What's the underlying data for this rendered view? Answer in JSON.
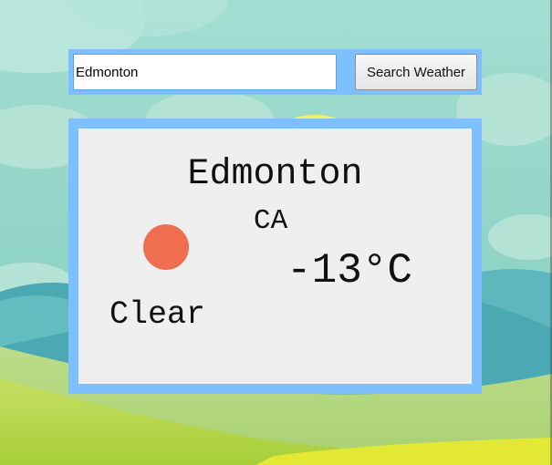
{
  "search": {
    "value": "Edmonton",
    "button_label": "Search Weather"
  },
  "weather": {
    "city": "Edmonton",
    "country": "CA",
    "temperature": "-13°C",
    "condition": "Clear",
    "icon": "sun-icon"
  },
  "colors": {
    "frame": "#7dbfff",
    "card": "#efefef",
    "sun": "#ef6e50",
    "sky": "#8fd5c8",
    "hills_green": "#b8d86a",
    "grass_yellow": "#d8e42a"
  }
}
